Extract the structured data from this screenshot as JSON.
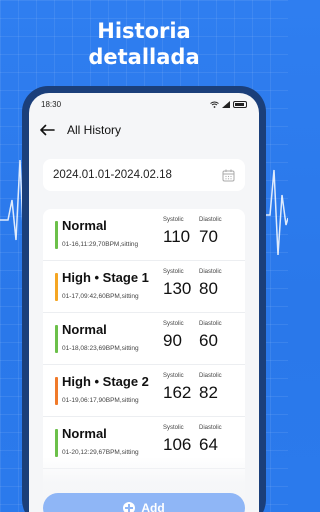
{
  "headline": {
    "line1": "Historia",
    "line2": "detallada"
  },
  "statusbar": {
    "time": "18:30"
  },
  "appbar": {
    "title": "All History"
  },
  "date_range": {
    "value": "2024.01.01-2024.02.18"
  },
  "labels": {
    "systolic": "Systolic",
    "diastolic": "Diastolic"
  },
  "records": [
    {
      "status": "Normal",
      "meta": "01-16,11:29,70BPM,sitting",
      "systolic": "110",
      "diastolic": "70",
      "color": "#6cc04a"
    },
    {
      "status": "High • Stage 1",
      "meta": "01-17,09:42,60BPM,sitting",
      "systolic": "130",
      "diastolic": "80",
      "color": "#f5a623"
    },
    {
      "status": "Normal",
      "meta": "01-18,08:23,69BPM,sitting",
      "systolic": "90",
      "diastolic": "60",
      "color": "#6cc04a"
    },
    {
      "status": "High • Stage 2",
      "meta": "01-19,06:17,90BPM,sitting",
      "systolic": "162",
      "diastolic": "82",
      "color": "#f07a2a"
    },
    {
      "status": "Normal",
      "meta": "01-20,12:29,67BPM,sitting",
      "systolic": "106",
      "diastolic": "64",
      "color": "#6cc04a"
    }
  ],
  "add_button": {
    "label": "Add"
  }
}
